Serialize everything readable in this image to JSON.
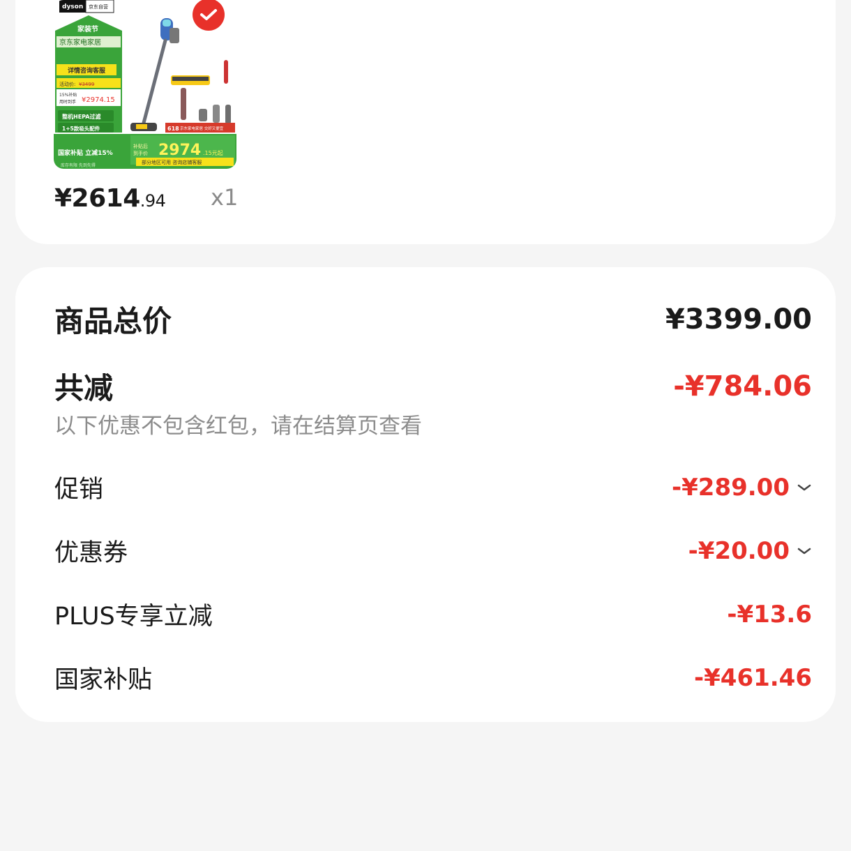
{
  "product": {
    "image_brand": "dyson",
    "image_store": "京东自营",
    "image_event": "家装节",
    "image_channel": "京东家电家居",
    "image_consult": "详情咨询客服",
    "image_orig_label": "活动价:",
    "image_orig_price": "¥3499",
    "image_sub_label_1": "15%补贴",
    "image_sub_label_2": "用时到手",
    "image_sub_price": "¥2974.15",
    "image_feature_1": "整机HEPA过滤",
    "image_feature_2": "1+5款吸头配件",
    "image_tag_618": "618",
    "image_tag_text": "京东家电家居 交好又便宜",
    "image_subsidy_label": "国家补贴 立减15%",
    "image_after_label_1": "补贴后",
    "image_after_label_2": "到手价",
    "image_after_price": "2974",
    "image_after_suffix": ".15元起",
    "image_area_note": "部分地区可用 咨询店铺客服",
    "image_stock_note": "库存有限 先到先得",
    "price_int": "¥2614",
    "price_dec": ".94",
    "quantity": "x1",
    "selected": true,
    "colors": {
      "check": "#e8312a",
      "banner_green": "#3aa43a",
      "banner_yellow": "#f7e11a"
    }
  },
  "summary": {
    "total_label": "商品总价",
    "total_value": "¥3399.00",
    "discount_label": "共减",
    "discount_value": "-¥784.06",
    "discount_note": "以下优惠不包含红包，请在结算页查看",
    "items": [
      {
        "label": "促销",
        "value": "-¥289.00",
        "expandable": true
      },
      {
        "label": "优惠券",
        "value": "-¥20.00",
        "expandable": true
      },
      {
        "label": "PLUS专享立减",
        "value": "-¥13.6",
        "expandable": false
      },
      {
        "label": "国家补贴",
        "value": "-¥461.46",
        "expandable": false
      }
    ],
    "colors": {
      "accent": "#e8312a",
      "text": "#1a1a1a",
      "muted": "#8c8c8c"
    }
  }
}
